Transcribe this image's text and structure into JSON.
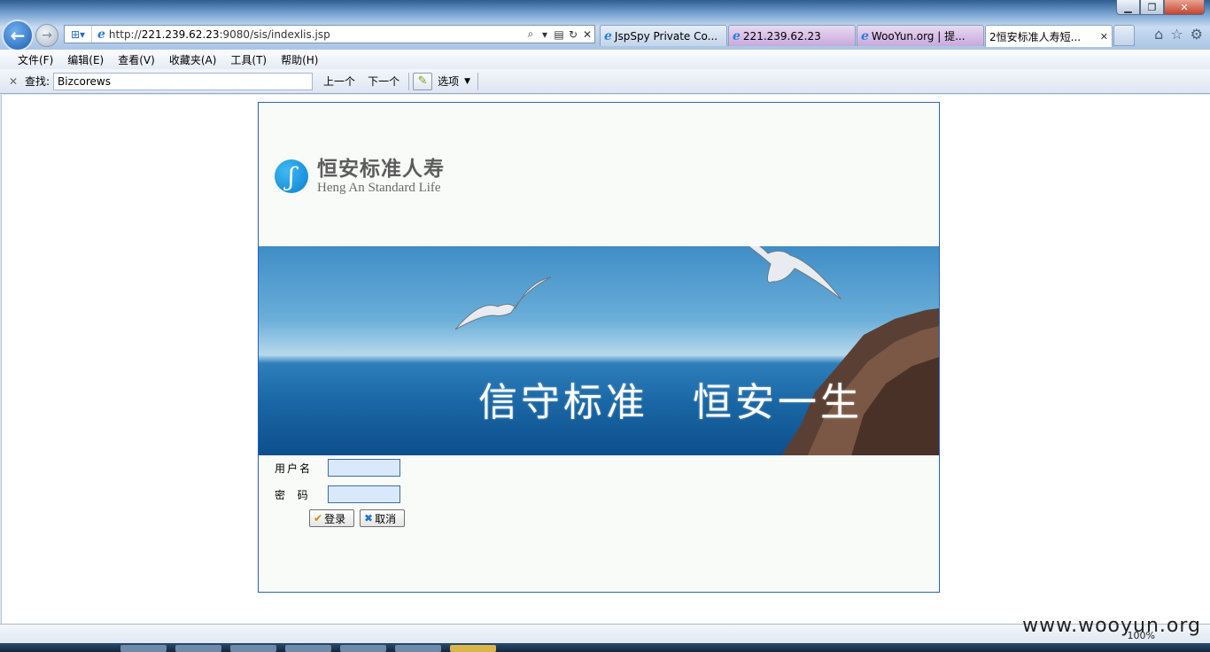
{
  "browser": {
    "address": {
      "url_prefix": "http://",
      "url_host": "221.239.62.23",
      "url_rest": ":9080/sis/indexlis.jsp"
    },
    "tabs": [
      {
        "label": "JspSpy Private Co...",
        "style": "normal"
      },
      {
        "label": "221.239.62.23",
        "style": "purple"
      },
      {
        "label": "WooYun.org | 提...",
        "style": "purple"
      },
      {
        "label": "2恒安标准人寿短...",
        "style": "active"
      }
    ],
    "menu": [
      "文件(F)",
      "编辑(E)",
      "查看(V)",
      "收藏夹(A)",
      "工具(T)",
      "帮助(H)"
    ],
    "find": {
      "label": "查找:",
      "value": "Bizcorews",
      "prev": "上一个",
      "next": "下一个",
      "options": "选项"
    },
    "status": {
      "zoom": "100%",
      "watermark": "www.wooyun.org"
    }
  },
  "login": {
    "logo_cn": "恒安标准人寿",
    "logo_en": "Heng An Standard Life",
    "slogan_1": "信守标准",
    "slogan_2": "恒安一生",
    "username_label": "用户名",
    "password_label": "密  码",
    "login_button": "登录",
    "cancel_button": "取消"
  }
}
